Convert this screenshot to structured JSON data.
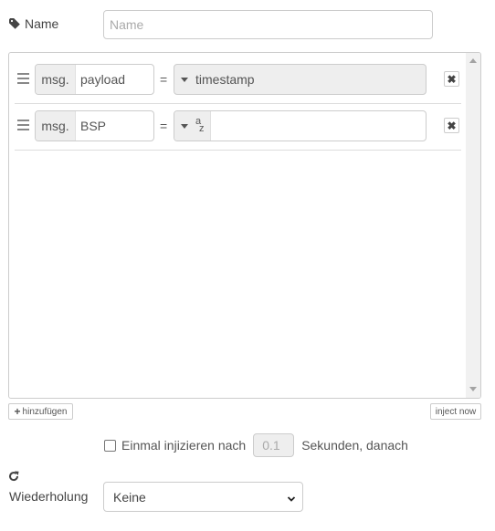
{
  "name_field": {
    "label": "Name",
    "placeholder": "Name",
    "value": ""
  },
  "properties": [
    {
      "prefix": "msg.",
      "property": "payload",
      "operator": "=",
      "value_type": "timestamp",
      "value": ""
    },
    {
      "prefix": "msg.",
      "property": "BSP",
      "operator": "=",
      "value_type": "string",
      "type_glyph_top": "a",
      "type_glyph_bottom": "z",
      "value": ""
    }
  ],
  "buttons": {
    "add_label": "hinzufügen",
    "inject_label": "inject now"
  },
  "once": {
    "label_before": "Einmal injizieren nach",
    "delay_value": "0.1",
    "label_after": "Sekunden, danach",
    "checked": false
  },
  "repeat": {
    "label": "Wiederholung",
    "selected": "Keine"
  },
  "icons": [
    "tag-icon",
    "drag-handle-icon",
    "caret-down-icon",
    "close-icon",
    "plus-icon",
    "refresh-icon",
    "chevron-down-icon"
  ]
}
